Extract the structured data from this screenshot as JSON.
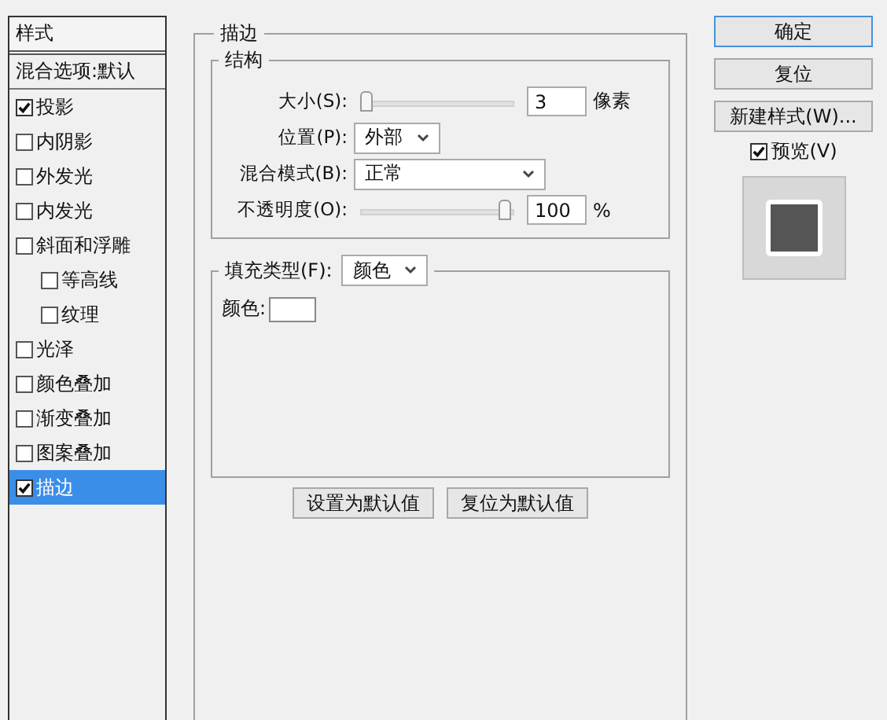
{
  "sidebar": {
    "header": "样式",
    "items": [
      {
        "label": "混合选项:默认",
        "kind": "plain",
        "selected": false
      },
      {
        "label": "投影",
        "kind": "check",
        "checked": true,
        "selected": false
      },
      {
        "label": "内阴影",
        "kind": "check",
        "checked": false,
        "selected": false
      },
      {
        "label": "外发光",
        "kind": "check",
        "checked": false,
        "selected": false
      },
      {
        "label": "内发光",
        "kind": "check",
        "checked": false,
        "selected": false
      },
      {
        "label": "斜面和浮雕",
        "kind": "check",
        "checked": false,
        "selected": false,
        "children": [
          {
            "label": "等高线",
            "kind": "check",
            "checked": false,
            "selected": false
          },
          {
            "label": "纹理",
            "kind": "check",
            "checked": false,
            "selected": false
          }
        ]
      },
      {
        "label": "光泽",
        "kind": "check",
        "checked": false,
        "selected": false
      },
      {
        "label": "颜色叠加",
        "kind": "check",
        "checked": false,
        "selected": false
      },
      {
        "label": "渐变叠加",
        "kind": "check",
        "checked": false,
        "selected": false
      },
      {
        "label": "图案叠加",
        "kind": "check",
        "checked": false,
        "selected": false
      },
      {
        "label": "描边",
        "kind": "check",
        "checked": true,
        "selected": true
      }
    ]
  },
  "stroke": {
    "title": "描边",
    "structure": {
      "title": "结构",
      "size": {
        "label": "大小(S):",
        "level": 0.0,
        "value": "3",
        "unit": "像素"
      },
      "position": {
        "label": "位置(P):",
        "value": "外部"
      },
      "blend_mode": {
        "label": "混合模式(B):",
        "value": "正常"
      },
      "opacity": {
        "label": "不透明度(O):",
        "level": 1,
        "value": "100",
        "unit": "%"
      }
    },
    "fill": {
      "label": "填充类型(F):",
      "value": "颜色",
      "color_label": "颜色:",
      "color": "#ffffff"
    },
    "buttons": [
      "设置为默认值",
      "复位为默认值"
    ]
  },
  "actions": {
    "buttons": [
      "确定",
      "复位",
      "新建样式(W)..."
    ],
    "preview": {
      "label": "预览(V)",
      "checked": true
    }
  }
}
